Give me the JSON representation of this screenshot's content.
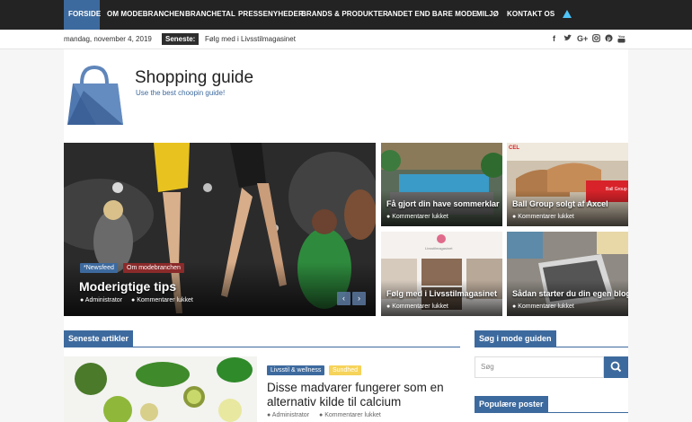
{
  "nav": {
    "items": [
      "FORSIDE",
      "OM MODEBRANCHEN",
      "BRANCHETAL",
      "PRESSENYHEDER",
      "BRANDS & PRODUKTER",
      "ANDET END BARE MODE",
      "MILJØ",
      "KONTAKT OS"
    ],
    "warning_icon": "warning-icon"
  },
  "topbar": {
    "date": "mandag, november 4, 2019",
    "latest_label": "Seneste:",
    "latest_text": "Følg med i Livsstilmagasinet",
    "social": [
      "f",
      "t",
      "G+",
      "ig",
      "p",
      "yt"
    ]
  },
  "site": {
    "title": "Shopping guide",
    "tagline": "Use the best choopin guide!"
  },
  "slider": {
    "main": {
      "categories": [
        "*Newsfeed",
        "Om modebranchen"
      ],
      "title": "Moderigtige tips",
      "author": "Administrator",
      "comments": "Kommentarer lukket"
    },
    "tiles": [
      {
        "title": "Få gjort din have sommerklar",
        "comments": "Kommentarer lukket"
      },
      {
        "title": "Ball Group solgt af Axcel",
        "comments": "Kommentarer lukket",
        "badge": "Ball Group",
        "corner_text": "CEL"
      },
      {
        "title": "Følg med i Livsstilmagasinet",
        "comments": "Kommentarer lukket",
        "banner_text": "Livsstilmagasinet"
      },
      {
        "title": "Sådan starter du din egen blog",
        "comments": "Kommentarer lukket"
      }
    ],
    "prev": "‹",
    "next": "›"
  },
  "latest": {
    "heading": "Seneste artikler",
    "article": {
      "categories": [
        "Livsstil & wellness",
        "Sundhed"
      ],
      "title": "Disse madvarer fungerer som en alternativ kilde til calcium",
      "author": "Administrator",
      "comments": "Kommentarer lukket"
    }
  },
  "sidebar": {
    "search_heading": "Søg i mode guiden",
    "search_placeholder": "Søg",
    "popular_heading": "Populære poster"
  },
  "colors": {
    "accent": "#3d6a9e",
    "nav_bg": "#232323",
    "category_red": "#8b2a2a",
    "category_yellow": "#f6d35a"
  }
}
